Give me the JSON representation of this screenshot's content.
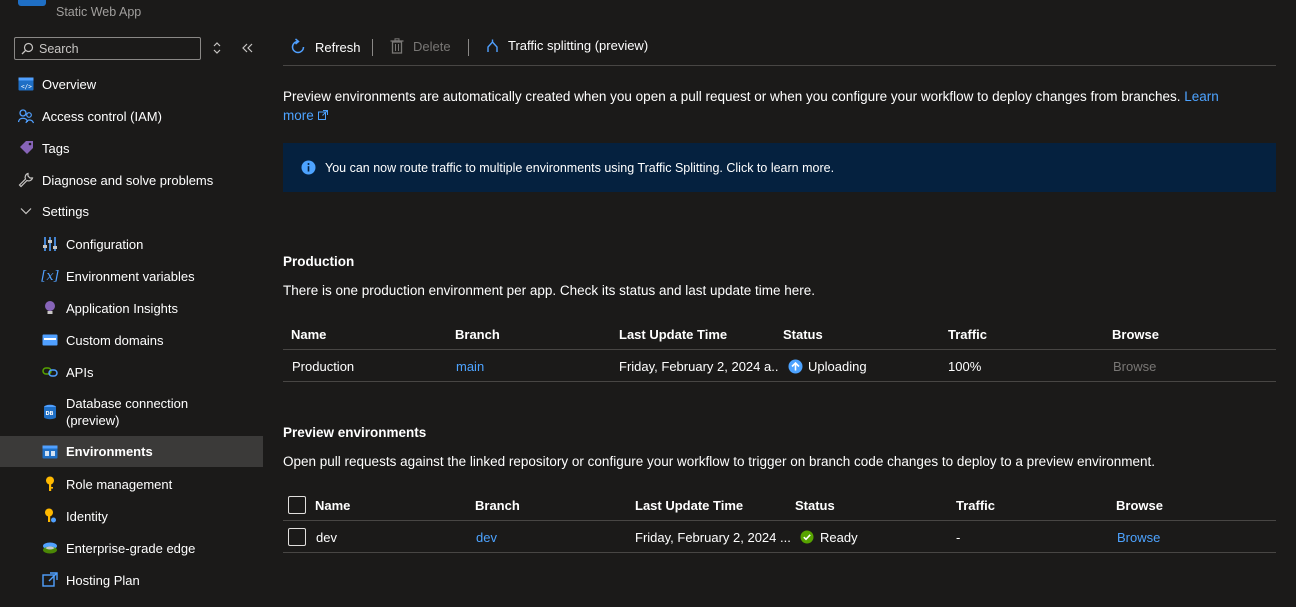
{
  "app": {
    "subtitle": "Static Web App"
  },
  "sidebar": {
    "search_placeholder": "Search",
    "items": [
      {
        "label": "Overview",
        "icon": "overview-icon"
      },
      {
        "label": "Access control (IAM)",
        "icon": "people-icon"
      },
      {
        "label": "Tags",
        "icon": "tag-icon"
      },
      {
        "label": "Diagnose and solve problems",
        "icon": "wrench-icon"
      },
      {
        "label": "Settings",
        "icon": "chevron-down-icon"
      },
      {
        "label": "Configuration",
        "icon": "sliders-icon"
      },
      {
        "label": "Environment variables",
        "icon": "variable-icon"
      },
      {
        "label": "Application Insights",
        "icon": "lightbulb-icon"
      },
      {
        "label": "Custom domains",
        "icon": "domain-icon"
      },
      {
        "label": "APIs",
        "icon": "link-icon"
      },
      {
        "label": "Database connection (preview)",
        "icon": "database-icon"
      },
      {
        "label": "Environments",
        "icon": "environments-icon"
      },
      {
        "label": "Role management",
        "icon": "key-icon"
      },
      {
        "label": "Identity",
        "icon": "identity-icon"
      },
      {
        "label": "Enterprise-grade edge",
        "icon": "edge-icon"
      },
      {
        "label": "Hosting Plan",
        "icon": "hosting-plan-icon"
      }
    ]
  },
  "toolbar": {
    "refresh": "Refresh",
    "delete": "Delete",
    "traffic": "Traffic splitting (preview)"
  },
  "intro": {
    "text": "Preview environments are automatically created when you open a pull request or when you configure your workflow to deploy changes from branches.",
    "learn_link_1": "Learn",
    "learn_link_2": "more"
  },
  "info_bar": {
    "text": "You can now route traffic to multiple environments using Traffic Splitting. Click to learn more."
  },
  "production": {
    "title": "Production",
    "description": "There is one production environment per app. Check its status and last update time here.",
    "columns": [
      "Name",
      "Branch",
      "Last Update Time",
      "Status",
      "Traffic",
      "Browse"
    ],
    "rows": [
      {
        "name": "Production",
        "branch": "main",
        "last_update": "Friday, February 2, 2024 a...",
        "status": "Uploading",
        "traffic": "100%",
        "browse": "Browse"
      }
    ]
  },
  "preview": {
    "title": "Preview environments",
    "description": "Open pull requests against the linked repository or configure your workflow to trigger on branch code changes to deploy to a preview environment.",
    "columns": [
      "Name",
      "Branch",
      "Last Update Time",
      "Status",
      "Traffic",
      "Browse"
    ],
    "rows": [
      {
        "name": "dev",
        "branch": "dev",
        "last_update": "Friday, February 2, 2024 ...",
        "status": "Ready",
        "traffic": "-",
        "browse": "Browse"
      }
    ]
  },
  "colors": {
    "accent": "#4da3ff",
    "info_bg": "#05213f",
    "success": "#57a300"
  }
}
